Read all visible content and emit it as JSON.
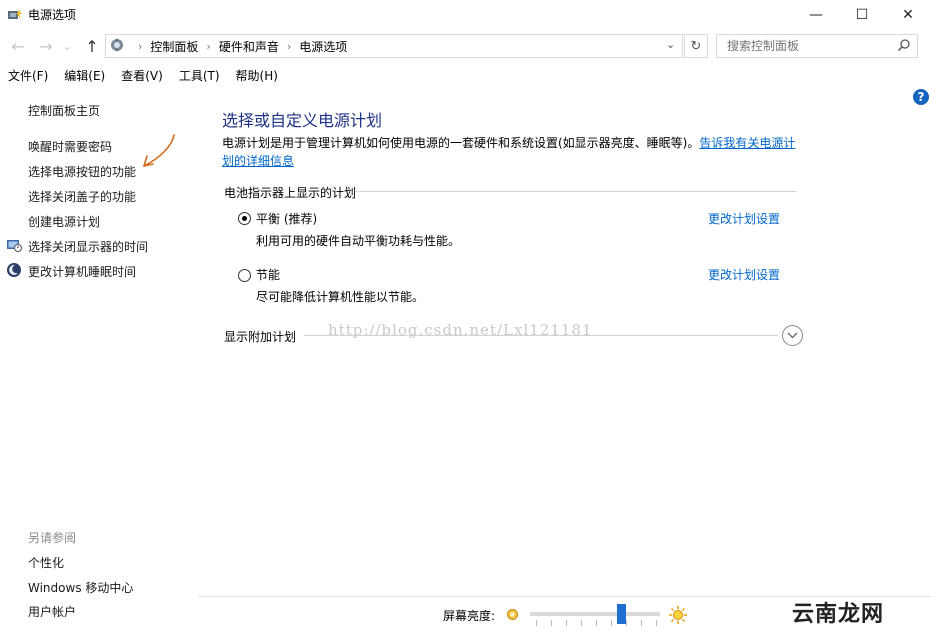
{
  "window": {
    "title": "电源选项",
    "minimize": "—",
    "maximize": "☐",
    "close": "✕"
  },
  "navigation": {
    "back": "←",
    "forward": "→",
    "dropdown": "⌄",
    "up": "↑",
    "breadcrumb": [
      "控制面板",
      "硬件和声音",
      "电源选项"
    ],
    "refresh": "↻",
    "search_placeholder": "搜索控制面板"
  },
  "menu": [
    "文件(F)",
    "编辑(E)",
    "查看(V)",
    "工具(T)",
    "帮助(H)"
  ],
  "sidebar": {
    "home": "控制面板主页",
    "links": [
      "唤醒时需要密码",
      "选择电源按钮的功能",
      "选择关闭盖子的功能",
      "创建电源计划",
      "选择关闭显示器的时间",
      "更改计算机睡眠时间"
    ],
    "see_also_title": "另请参阅",
    "see_also": [
      "个性化",
      "Windows 移动中心",
      "用户帐户"
    ]
  },
  "main": {
    "title": "选择或自定义电源计划",
    "desc_text": "电源计划是用于管理计算机如何使用电源的一套硬件和系统设置(如显示器亮度、睡眠等)。",
    "desc_link_1": "告诉我有关电源计",
    "desc_link_2": "划的详细信息",
    "section_header": "电池指示器上显示的计划",
    "plans": [
      {
        "name": "平衡 (推荐)",
        "desc": "利用可用的硬件自动平衡功耗与性能。",
        "link": "更改计划设置",
        "selected": true
      },
      {
        "name": "节能",
        "desc": "尽可能降低计算机性能以节能。",
        "link": "更改计划设置",
        "selected": false
      }
    ],
    "additional_plans": "显示附加计划",
    "watermark": "http://blog.csdn.net/Lxl121181",
    "help": "?"
  },
  "bottom": {
    "brightness_label": "屏幕亮度:",
    "brightness_level": 0.7,
    "site_logo": "云南龙网"
  },
  "colors": {
    "title_blue": "#1e3287",
    "link_blue": "#0066cc",
    "slider_blue": "#1f6fd0",
    "annotation_arrow": "#d2691e"
  }
}
